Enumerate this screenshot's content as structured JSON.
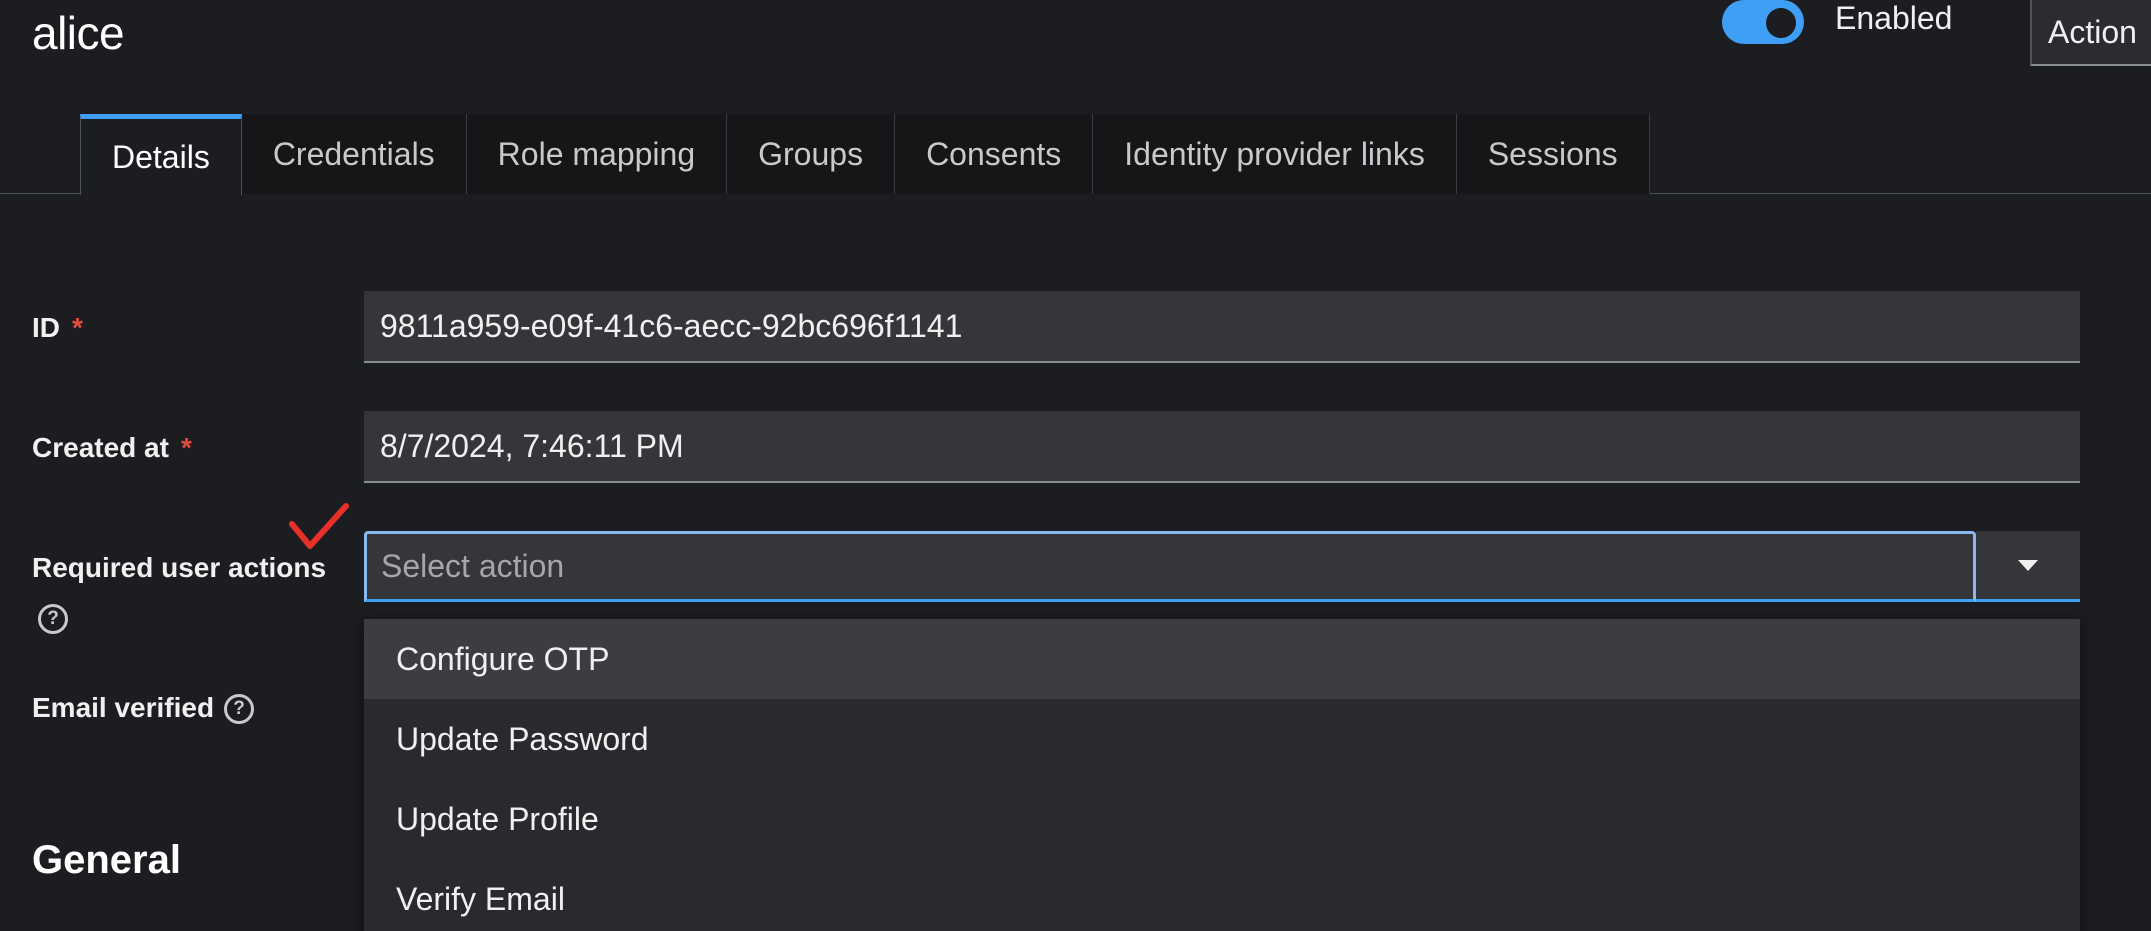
{
  "header": {
    "title": "alice",
    "toggle_label": "Enabled",
    "action_label": "Action"
  },
  "tabs": [
    {
      "label": "Details"
    },
    {
      "label": "Credentials"
    },
    {
      "label": "Role mapping"
    },
    {
      "label": "Groups"
    },
    {
      "label": "Consents"
    },
    {
      "label": "Identity provider links"
    },
    {
      "label": "Sessions"
    }
  ],
  "form": {
    "id": {
      "label": "ID",
      "required_mark": "*",
      "value": "9811a959-e09f-41c6-aecc-92bc696f1141"
    },
    "created_at": {
      "label": "Created at",
      "required_mark": "*",
      "value": "8/7/2024, 7:46:11 PM"
    },
    "required_actions": {
      "label": "Required user actions",
      "placeholder": "Select action"
    },
    "email_verified": {
      "label": "Email verified"
    }
  },
  "menu": {
    "items": [
      {
        "label": "Configure OTP"
      },
      {
        "label": "Update Password"
      },
      {
        "label": "Update Profile"
      },
      {
        "label": "Verify Email"
      }
    ]
  },
  "sections": {
    "general": "General"
  },
  "colors": {
    "accent": "#3f9ff5",
    "required": "#e44c3c",
    "annotation": "#e8302a",
    "background": "#1b1d21"
  }
}
